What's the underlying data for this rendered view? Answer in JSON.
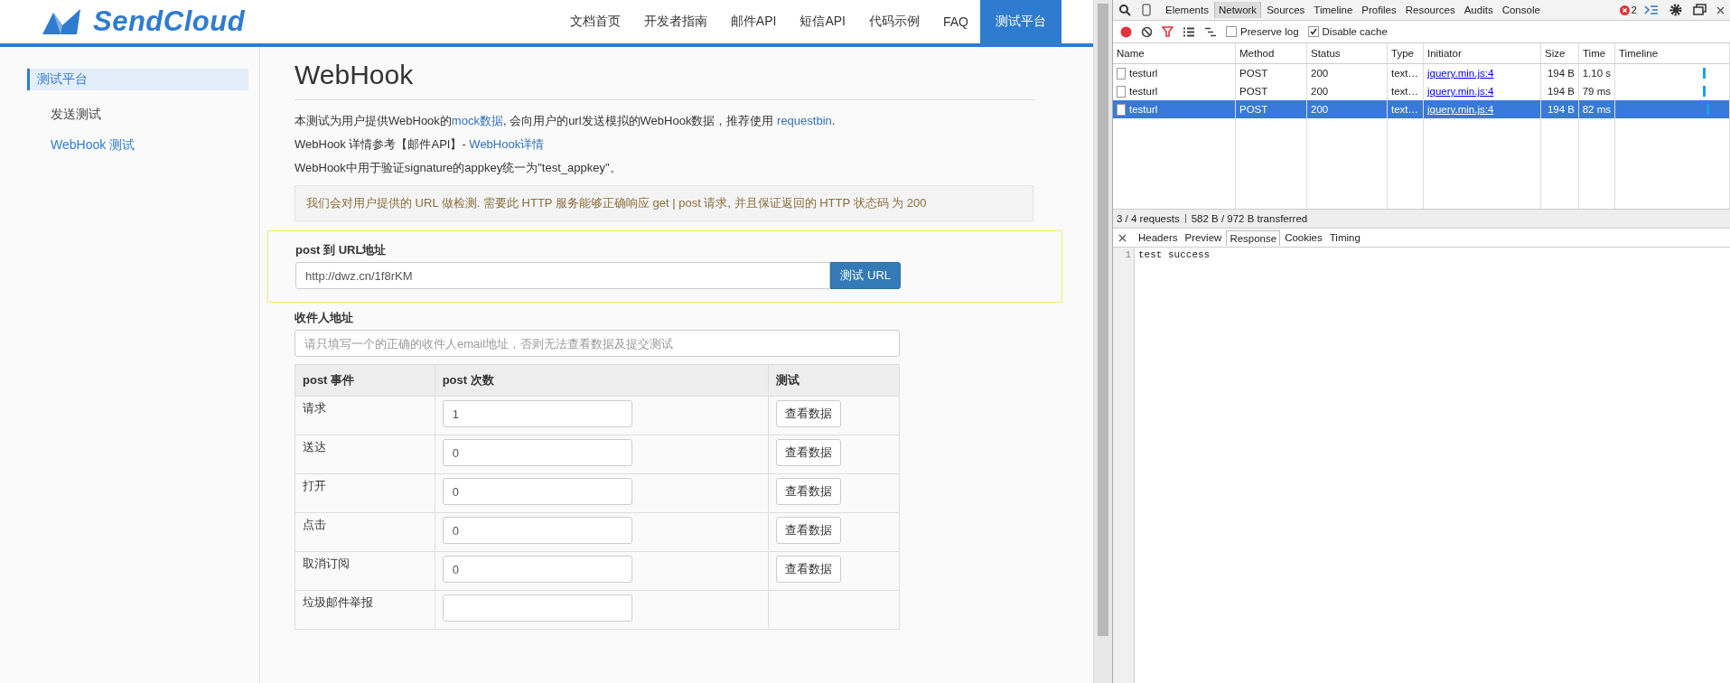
{
  "logo": {
    "text": "SendCloud"
  },
  "nav": [
    {
      "label": "文档首页",
      "selected": false
    },
    {
      "label": "开发者指南",
      "selected": false
    },
    {
      "label": "邮件API",
      "selected": false
    },
    {
      "label": "短信API",
      "selected": false
    },
    {
      "label": "代码示例",
      "selected": false
    },
    {
      "label": "FAQ",
      "selected": false
    },
    {
      "label": "测试平台",
      "selected": true
    }
  ],
  "sidebar": {
    "items": [
      {
        "label": "测试平台",
        "selected": true,
        "kind": "section"
      },
      {
        "label": "发送测试",
        "selected": false,
        "kind": "item"
      },
      {
        "label": "WebHook 测试",
        "selected": true,
        "kind": "item"
      }
    ]
  },
  "content": {
    "heading": "WebHook",
    "paragraphs": [
      [
        {
          "text": "本测试为用户提供WebHook的"
        },
        {
          "text": "mock数据",
          "kind": "link"
        },
        {
          "text": ", 会向用户的url发送模拟的WebHook数据，推荐使用 "
        },
        {
          "text": "requestbin",
          "kind": "link"
        },
        {
          "text": "."
        }
      ],
      [
        {
          "text": "WebHook 详情参考【邮件API】- "
        },
        {
          "text": "WebHook详情",
          "kind": "link"
        }
      ],
      [
        {
          "text": "WebHook中用于验证signature的appkey统一为\"test_appkey\"。"
        }
      ]
    ],
    "notice": "我们会对用户提供的 URL 做检测. 需要此 HTTP 服务能够正确响应 get | post 请求, 并且保证返回的 HTTP 状态码 为 200",
    "url_field": {
      "label": "post 到 URL地址",
      "value": "http://dwz.cn/1f8rKM",
      "button": "测试 URL"
    },
    "recipient_field": {
      "label": "收件人地址",
      "placeholder": "请只填写一个的正确的收件人email地址，否则无法查看数据及提交测试"
    },
    "table": {
      "columns": [
        "post 事件",
        "post 次数",
        "测试"
      ],
      "rows": [
        {
          "event": "请求",
          "count": "1",
          "action": "查看数据"
        },
        {
          "event": "送达",
          "count": "0",
          "action": "查看数据"
        },
        {
          "event": "打开",
          "count": "0",
          "action": "查看数据"
        },
        {
          "event": "点击",
          "count": "0",
          "action": "查看数据"
        },
        {
          "event": "取消订阅",
          "count": "0",
          "action": "查看数据"
        },
        {
          "event": "垃圾邮件举报"
        }
      ]
    }
  },
  "devtools": {
    "tabs": [
      {
        "label": "Elements",
        "selected": false
      },
      {
        "label": "Network",
        "selected": true
      },
      {
        "label": "Sources",
        "selected": false
      },
      {
        "label": "Timeline",
        "selected": false
      },
      {
        "label": "Profiles",
        "selected": false
      },
      {
        "label": "Resources",
        "selected": false
      },
      {
        "label": "Audits",
        "selected": false
      },
      {
        "label": "Console",
        "selected": false
      }
    ],
    "error_count": "2",
    "preserve_log": {
      "label": "Preserve log",
      "checked": false
    },
    "disable_cache": {
      "label": "Disable cache",
      "checked": true
    },
    "columns": [
      "Name",
      "Method",
      "Status",
      "Type",
      "Initiator",
      "Size",
      "Time",
      "Timeline"
    ],
    "rows": [
      {
        "name": "testurl",
        "method": "POST",
        "status": "200",
        "type": "text…",
        "initiator": "jquery.min.js:4",
        "size": "194 B",
        "time": "1.10 s",
        "selected": false
      },
      {
        "name": "testurl",
        "method": "POST",
        "status": "200",
        "type": "text…",
        "initiator": "jquery.min.js:4",
        "size": "194 B",
        "time": "79 ms",
        "selected": false
      },
      {
        "name": "testurl",
        "method": "POST",
        "status": "200",
        "type": "text…",
        "initiator": "jquery.min.js:4",
        "size": "194 B",
        "time": "82 ms",
        "selected": true
      }
    ],
    "summary": [
      "3 / 4 requests",
      "582 B / 972 B transferred"
    ],
    "detail_tabs": [
      {
        "label": "Headers",
        "selected": false
      },
      {
        "label": "Preview",
        "selected": false
      },
      {
        "label": "Response",
        "selected": true
      },
      {
        "label": "Cookies",
        "selected": false
      },
      {
        "label": "Timing",
        "selected": false
      }
    ],
    "response": [
      {
        "line": "1",
        "text": "test success"
      }
    ]
  }
}
